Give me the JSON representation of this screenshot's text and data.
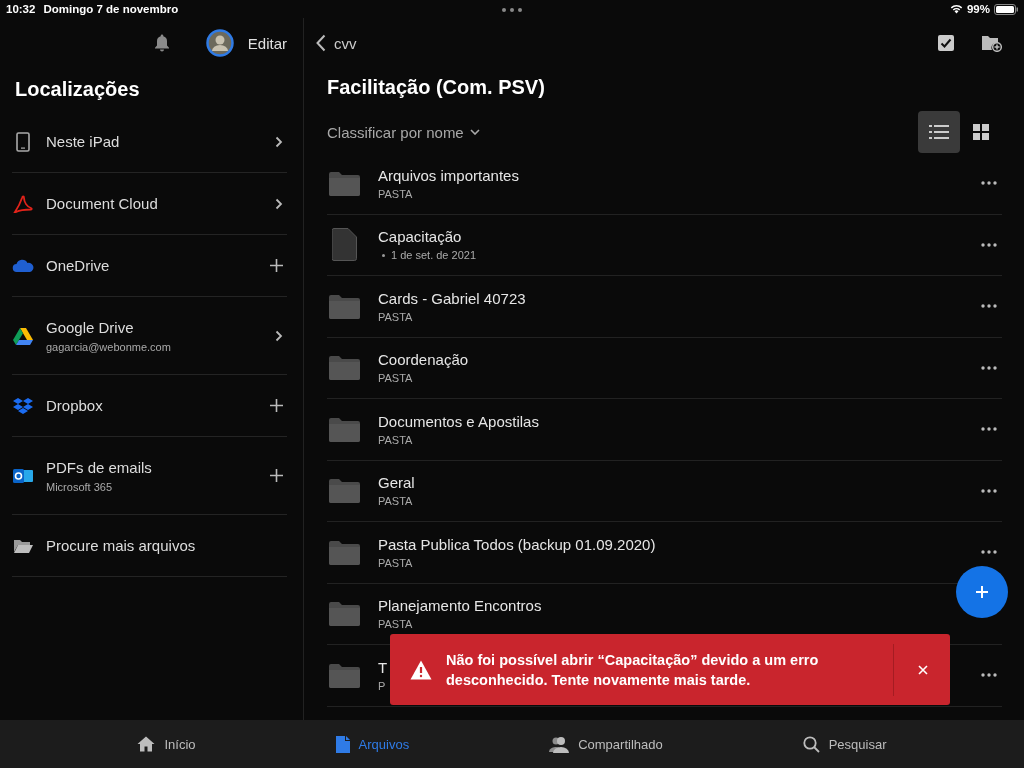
{
  "status_bar": {
    "time": "10:32",
    "date": "Domingo 7 de novembro",
    "battery": "99%"
  },
  "sidebar": {
    "edit_label": "Editar",
    "title": "Localizações",
    "locations": [
      {
        "kind": "device",
        "name": "Neste iPad",
        "chevron": true,
        "add": false
      },
      {
        "kind": "acrobat",
        "name": "Document Cloud",
        "chevron": true,
        "add": false
      },
      {
        "kind": "onedrive",
        "name": "OneDrive",
        "chevron": false,
        "add": true
      },
      {
        "kind": "gdrive",
        "name": "Google Drive",
        "subtitle": "gagarcia@webonme.com",
        "chevron": true,
        "add": false
      },
      {
        "kind": "dropbox",
        "name": "Dropbox",
        "chevron": false,
        "add": true
      },
      {
        "kind": "outlook",
        "name": "PDFs de emails",
        "subtitle": "Microsoft 365",
        "chevron": false,
        "add": true
      },
      {
        "kind": "folder",
        "name": "Procure mais arquivos",
        "chevron": false,
        "add": false
      }
    ]
  },
  "main": {
    "back_label": "cvv",
    "title": "Facilitação (Com. PSV)",
    "sort_label": "Classificar por nome",
    "views": [
      {
        "kind": "list",
        "selected": true
      },
      {
        "kind": "grid",
        "selected": false
      }
    ],
    "rows": [
      {
        "kind": "folder",
        "name": "Arquivos importantes",
        "meta": "PASTA",
        "menu": true
      },
      {
        "kind": "file",
        "name": "Capacitação",
        "meta": "1 de set. de 2021",
        "menu": true
      },
      {
        "kind": "folder",
        "name": "Cards - Gabriel 40723",
        "meta": "PASTA",
        "menu": true
      },
      {
        "kind": "folder",
        "name": "Coordenação",
        "meta": "PASTA",
        "menu": true
      },
      {
        "kind": "folder",
        "name": "Documentos e Apostilas",
        "meta": "PASTA",
        "menu": true
      },
      {
        "kind": "folder",
        "name": "Geral",
        "meta": "PASTA",
        "menu": true
      },
      {
        "kind": "folder",
        "name": "Pasta Publica Todos (backup 01.09.2020)",
        "meta": "PASTA",
        "menu": true
      },
      {
        "kind": "folder",
        "name": "Planejamento Encontros",
        "meta": "PASTA",
        "menu": false
      },
      {
        "kind": "folder",
        "name": "T",
        "meta": "P",
        "menu": true
      }
    ]
  },
  "toast": {
    "message": "Não foi possível abrir “Capacitação” devido a um erro desconhecido. Tente novamente mais tarde."
  },
  "tabs": [
    {
      "kind": "home",
      "label": "Início",
      "selected": false
    },
    {
      "kind": "files",
      "label": "Arquivos",
      "selected": true
    },
    {
      "kind": "shared",
      "label": "Compartilhado",
      "selected": false
    },
    {
      "kind": "search",
      "label": "Pesquisar",
      "selected": false
    }
  ]
}
